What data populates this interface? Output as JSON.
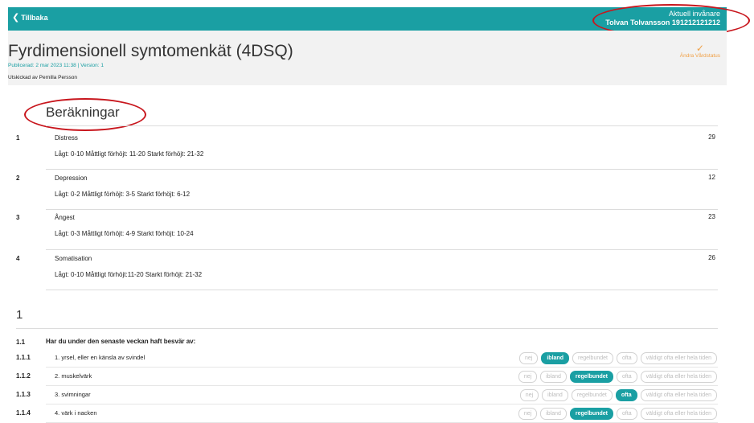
{
  "topbar": {
    "back_label": "Tillbaka",
    "resident_label": "Aktuell invånare",
    "resident_name": "Tolvan Tolvansson 191212121212"
  },
  "header": {
    "title": "Fyrdimensionell symtomenkät (4DSQ)",
    "published": "Publicerad: 2 mar 2023 11:38 | Version: 1",
    "sent_by": "Utskickad av Pernilla Persson",
    "status_label": "Ändra Vårdstatus",
    "status_icon": "check-icon"
  },
  "calculations": {
    "heading": "Beräkningar",
    "rows": [
      {
        "num": "1",
        "name": "Distress",
        "range": "Lågt: 0-10 Måttligt förhöjt: 11-20 Starkt förhöjt: 21-32",
        "value": "29"
      },
      {
        "num": "2",
        "name": "Depression",
        "range": "Lågt: 0-2 Måttligt förhöjt: 3-5 Starkt förhöjt: 6-12",
        "value": "12"
      },
      {
        "num": "3",
        "name": "Ångest",
        "range": "Lågt: 0-3 Måttligt förhöjt: 4-9 Starkt förhöjt: 10-24",
        "value": "23"
      },
      {
        "num": "4",
        "name": "Somatisation",
        "range": "Lågt: 0-10 Måttligt förhöjt:11-20 Starkt förhöjt: 21-32",
        "value": "26"
      }
    ]
  },
  "section": {
    "num": "1",
    "question_group_num": "1.1",
    "question_group_title": "Har du under den senaste veckan haft besvär av:",
    "options": [
      "nej",
      "ibland",
      "regelbundet",
      "ofta",
      "väldigt ofta eller hela tiden"
    ],
    "questions": [
      {
        "num": "1.1.1",
        "text": "1. yrsel, eller en känsla av svindel",
        "selected": 1
      },
      {
        "num": "1.1.2",
        "text": "2. muskelvärk",
        "selected": 2
      },
      {
        "num": "1.1.3",
        "text": "3. svimningar",
        "selected": 3
      },
      {
        "num": "1.1.4",
        "text": "4. värk i nacken",
        "selected": 2
      }
    ]
  },
  "colors": {
    "accent": "#1a9fa3",
    "status": "#f0a046",
    "annotation": "#c8161d"
  }
}
